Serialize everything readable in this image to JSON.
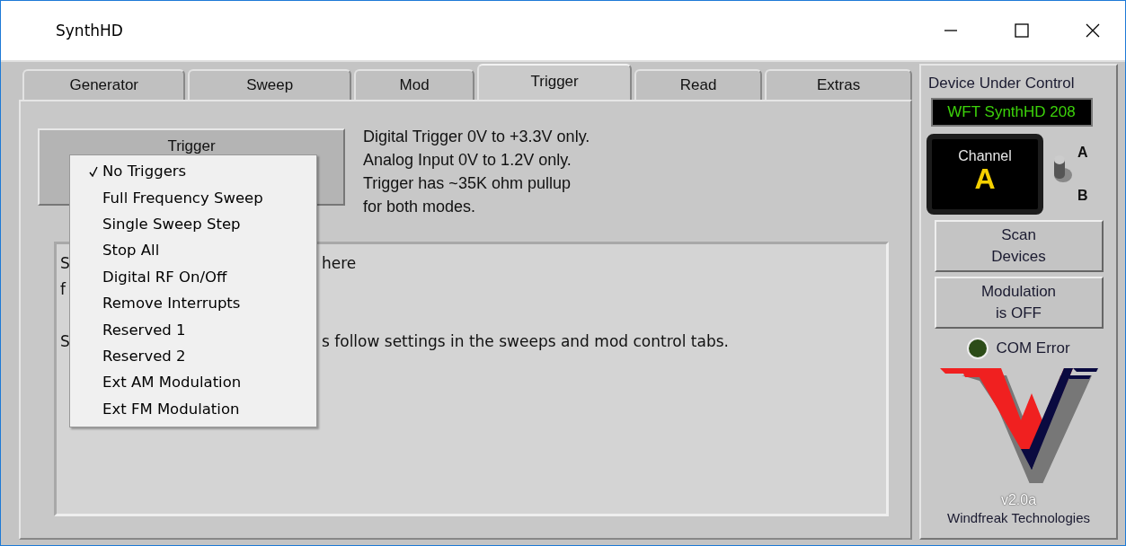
{
  "window": {
    "title": "SynthHD"
  },
  "tabs": [
    {
      "label": "Generator",
      "selected": false
    },
    {
      "label": "Sweep",
      "selected": false
    },
    {
      "label": "Mod",
      "selected": false
    },
    {
      "label": "Trigger",
      "selected": true
    },
    {
      "label": "Read",
      "selected": false
    },
    {
      "label": "Extras",
      "selected": false
    }
  ],
  "trigger_button": {
    "label": "Trigger"
  },
  "trigger_info": [
    "Digital Trigger 0V to +3.3V only.",
    "Analog Input 0V to 1.2V only.",
    "Trigger has ~35K ohm pullup",
    "for both modes."
  ],
  "trigger_menu": [
    {
      "label": "No Triggers",
      "checked": true
    },
    {
      "label": "Full Frequency Sweep",
      "checked": false
    },
    {
      "label": "Single Sweep Step",
      "checked": false
    },
    {
      "label": "Stop All",
      "checked": false
    },
    {
      "label": "Digital RF On/Off",
      "checked": false
    },
    {
      "label": "Remove Interrupts",
      "checked": false
    },
    {
      "label": "Reserved 1",
      "checked": false
    },
    {
      "label": "Reserved 2",
      "checked": false
    },
    {
      "label": "Ext AM Modulation",
      "checked": false
    },
    {
      "label": "Ext FM Modulation",
      "checked": false
    }
  ],
  "notes": [
    {
      "start": "S",
      "end": "here"
    },
    {
      "start": "f"
    },
    {
      "start": "S",
      "end": "s follow settings in the sweeps and mod control tabs.",
      "gap_before": true
    }
  ],
  "side_panel": {
    "heading": "Device Under Control",
    "device": "WFT SynthHD 208",
    "channel": {
      "label": "Channel",
      "value": "A"
    },
    "channel_switch": {
      "top_label": "A",
      "bottom_label": "B",
      "up": true
    },
    "buttons": [
      "Scan\nDevices",
      "Modulation\nis OFF"
    ],
    "com_error": {
      "label": "COM Error",
      "on": false
    },
    "version": "v2.0a",
    "company": "Windfreak Technologies"
  }
}
